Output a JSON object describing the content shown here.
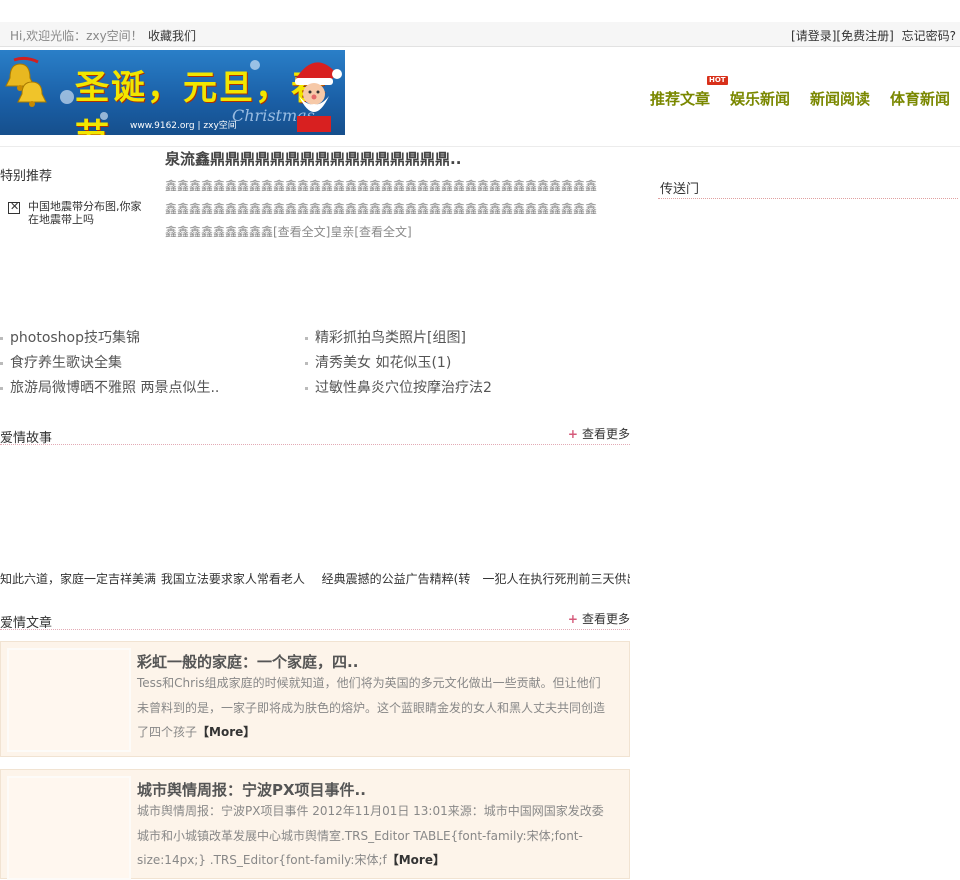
{
  "topbar": {
    "welcome": "Hi,欢迎光临：zxy空间！",
    "favorite": "收藏我们",
    "login": "[请登录]",
    "register": "[免费注册]",
    "forgot": "忘记密码?"
  },
  "banner": {
    "title": "圣诞，元旦，春节",
    "url": "www.9162.org | zxy空间",
    "script_text": "Christmas"
  },
  "nav": {
    "items": [
      "推荐文章",
      "娱乐新闻",
      "新闻阅读",
      "体育新闻"
    ],
    "hot_badge": "HOT"
  },
  "special": {
    "title": "特别推荐",
    "item": "中国地震带分布图,你家在地震带上吗"
  },
  "headline": {
    "title": "泉流鑫鼎鼎鼎鼎鼎鼎鼎鼎鼎鼎鼎鼎鼎鼎鼎鼎..",
    "line1": "鑫鑫鑫鑫鑫鑫鑫鑫鑫鑫鑫鑫鑫鑫鑫鑫鑫鑫鑫鑫鑫鑫鑫鑫鑫鑫鑫鑫鑫鑫鑫鑫鑫鑫鑫鑫",
    "line2": "鑫鑫鑫鑫鑫鑫鑫鑫鑫鑫鑫鑫鑫鑫鑫鑫鑫鑫鑫鑫鑫鑫鑫鑫鑫鑫鑫鑫鑫鑫鑫鑫鑫鑫鑫鑫",
    "line3": "鑫鑫鑫鑫鑫鑫鑫鑫鑫[查看全文]皇亲[查看全文]"
  },
  "sidebar": {
    "title": "传送门"
  },
  "links": {
    "left": [
      "photoshop技巧集锦",
      "食疗养生歌诀全集",
      "旅游局微博晒不雅照  两景点似生.."
    ],
    "right": [
      "精彩抓拍鸟类照片[组图]",
      "清秀美女  如花似玉(1)",
      "过敏性鼻炎穴位按摩治疗法2"
    ]
  },
  "love_story": {
    "title": "爱情故事",
    "more": "查看更多",
    "strip": [
      "知此六道，家庭一定吉祥美满",
      "我国立法要求家人常看老人",
      "经典震撼的公益广告精粹(转",
      "一犯人在执行死刑前三天供出"
    ]
  },
  "love_articles": {
    "title": "爱情文章",
    "more": "查看更多",
    "cards": [
      {
        "title": "彩虹一般的家庭：一个家庭，四..",
        "desc": "Tess和Chris组成家庭的时候就知道，他们将为英国的多元文化做出一些贡献。但让他们未曾料到的是，一家子即将成为肤色的熔炉。这个蓝眼睛金发的女人和黑人丈夫共同创造了四个孩子",
        "more": "【More】"
      },
      {
        "title": "城市舆情周报：宁波PX项目事件..",
        "desc": "城市舆情周报：宁波PX项目事件 2012年11月01日 13:01来源：城市中国网国家发改委城市和小城镇改革发展中心城市舆情室.TRS_Editor TABLE{font-family:宋体;font-size:14px;} .TRS_Editor{font-family:宋体;f",
        "more": "【More】"
      }
    ]
  }
}
